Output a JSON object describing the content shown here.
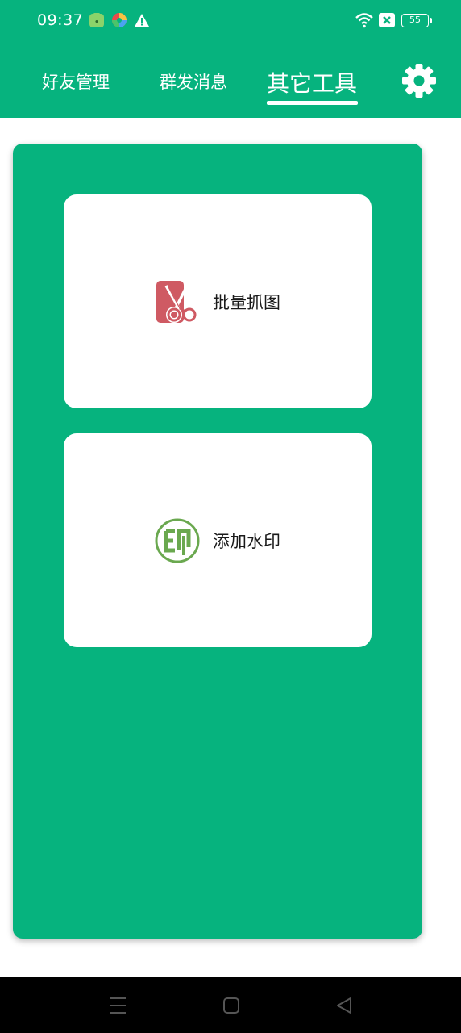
{
  "status_bar": {
    "time": "09:37",
    "battery": "55",
    "icons": [
      "shopping-app-icon",
      "colorful-app-icon",
      "alert-triangle-icon",
      "wifi-icon",
      "x-box-icon"
    ]
  },
  "tabs": [
    {
      "label": "好友管理",
      "active": false
    },
    {
      "label": "群发消息",
      "active": false
    },
    {
      "label": "其它工具",
      "active": true
    }
  ],
  "header": {
    "settings_icon": "gear-icon"
  },
  "tools": [
    {
      "label": "批量抓图",
      "icon": "scissors-image-icon"
    },
    {
      "label": "添加水印",
      "icon": "watermark-stamp-icon"
    }
  ],
  "navbar": {
    "icons": [
      "menu-icon",
      "home-icon",
      "back-icon"
    ]
  },
  "colors": {
    "brand_green": "#06b37e",
    "card_white": "#ffffff",
    "scissors_red": "#cf5a63",
    "stamp_green": "#6aa84f"
  }
}
